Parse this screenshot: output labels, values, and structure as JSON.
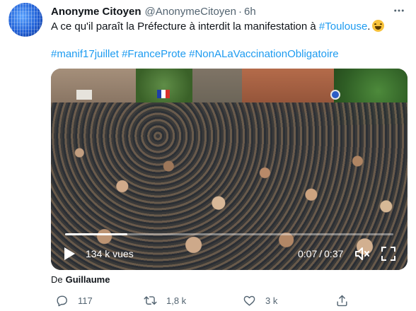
{
  "author": {
    "display_name": "Anonyme Citoyen",
    "handle": "@AnonymeCitoyen",
    "time_ago": "6h",
    "separator": "·"
  },
  "tweet": {
    "text_before": "A ce qu'il paraît la Préfecture à interdit la manifestation à ",
    "mention_hashtag": "#Toulouse",
    "text_after": ".",
    "emoji": "grinning-sweat-face",
    "hashtags": [
      "#manif17juillet",
      "#FranceProte",
      "#NonALaVaccinationObligatoire"
    ]
  },
  "video": {
    "views": "134 k vues",
    "current_time": "0:07",
    "time_separator": "/",
    "duration": "0:37",
    "progress_percent": 19
  },
  "attribution": {
    "from_label": "De",
    "source": "Guillaume"
  },
  "actions": {
    "reply_count": "117",
    "retweet_count": "1,8 k",
    "like_count": "3 k"
  },
  "colors": {
    "accent": "#1d9bf0",
    "text_primary": "#0f1419",
    "text_secondary": "#536471"
  }
}
